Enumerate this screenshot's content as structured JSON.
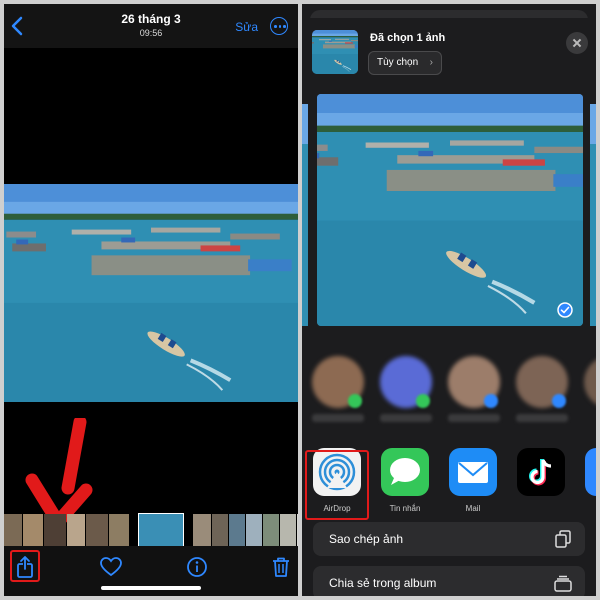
{
  "left_screen": {
    "header": {
      "date": "26 tháng 3",
      "time": "09:56",
      "edit_label": "Sửa"
    },
    "toolbar": {
      "icons": [
        "share-icon",
        "heart-icon",
        "info-icon",
        "trash-icon"
      ]
    }
  },
  "right_screen": {
    "header": {
      "selected_label": "Đã chọn 1 ảnh",
      "options_label": "Tùy chọn"
    },
    "apps": [
      {
        "label": "AirDrop",
        "icon": "airdrop-icon"
      },
      {
        "label": "Tin nhắn",
        "icon": "messages-icon"
      },
      {
        "label": "Mail",
        "icon": "mail-icon"
      },
      {
        "label": "",
        "icon": "tiktok-icon"
      }
    ],
    "actions": [
      {
        "label": "Sao chép ảnh",
        "icon": "copy-icon"
      },
      {
        "label": "Chia sẻ trong album",
        "icon": "shared-album-icon"
      }
    ]
  },
  "colors": {
    "accent_blue": "#2f88ff",
    "highlight_red": "#e11a1a",
    "messages_green": "#34c759"
  }
}
